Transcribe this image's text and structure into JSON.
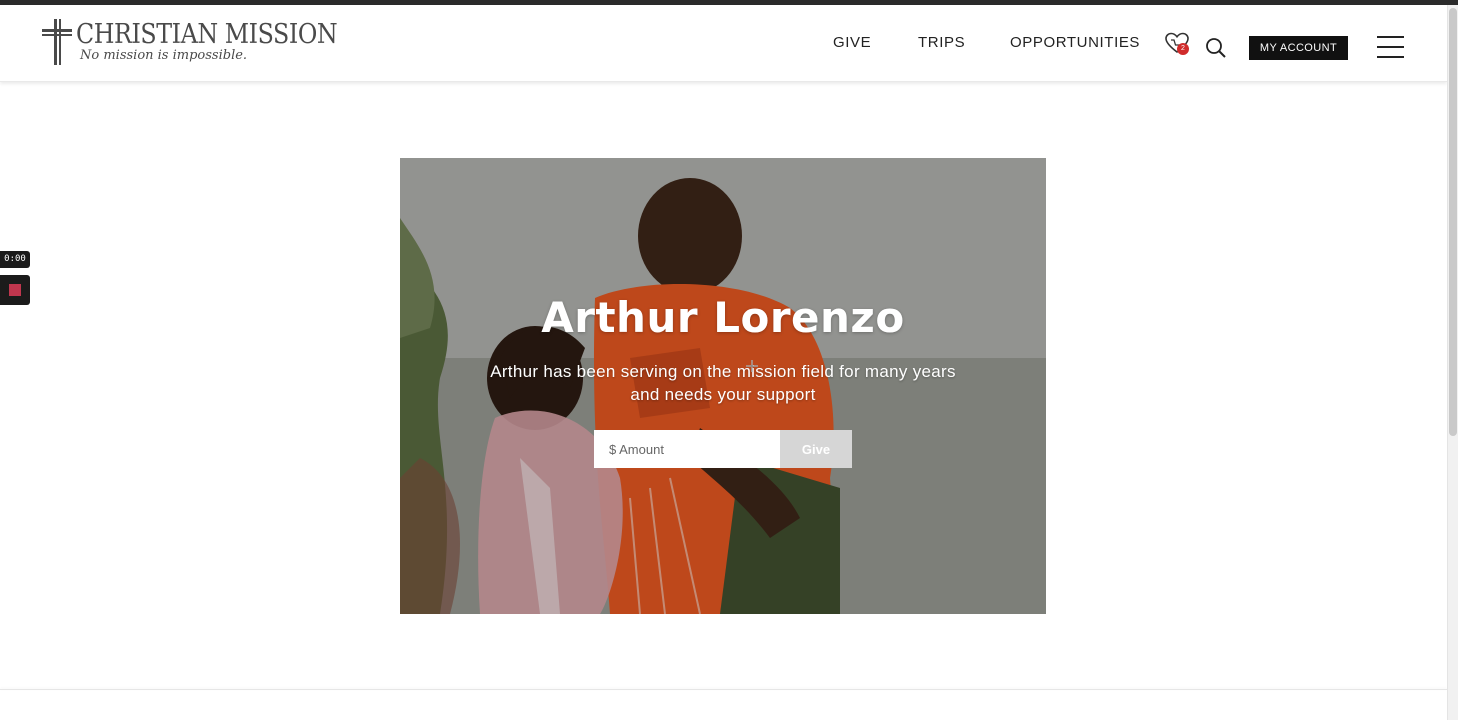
{
  "header": {
    "logo": {
      "title": "CHRISTIAN MISSION",
      "tagline": "No mission is impossible.",
      "icon": "cross-icon"
    },
    "nav": [
      {
        "label": "GIVE"
      },
      {
        "label": "TRIPS"
      },
      {
        "label": "OPPORTUNITIES"
      }
    ],
    "cart": {
      "icon": "heart-cart-icon",
      "count": "2",
      "badge_color": "#d02b2b"
    },
    "search": {
      "icon": "search-icon"
    },
    "account_label": "MY ACCOUNT",
    "menu": {
      "icon": "hamburger-menu-icon"
    }
  },
  "video_widget": {
    "timer": "0:00",
    "record_icon": "stop-square-icon",
    "record_color": "#c0364e"
  },
  "hero": {
    "title": "Arthur Lorenzo",
    "text": "Arthur has been serving on the mission field for many years and needs your support",
    "amount_placeholder": "$ Amount",
    "give_label": "Give"
  },
  "colors": {
    "accent_dark": "#111111",
    "give_button": "#d6d6d6"
  }
}
